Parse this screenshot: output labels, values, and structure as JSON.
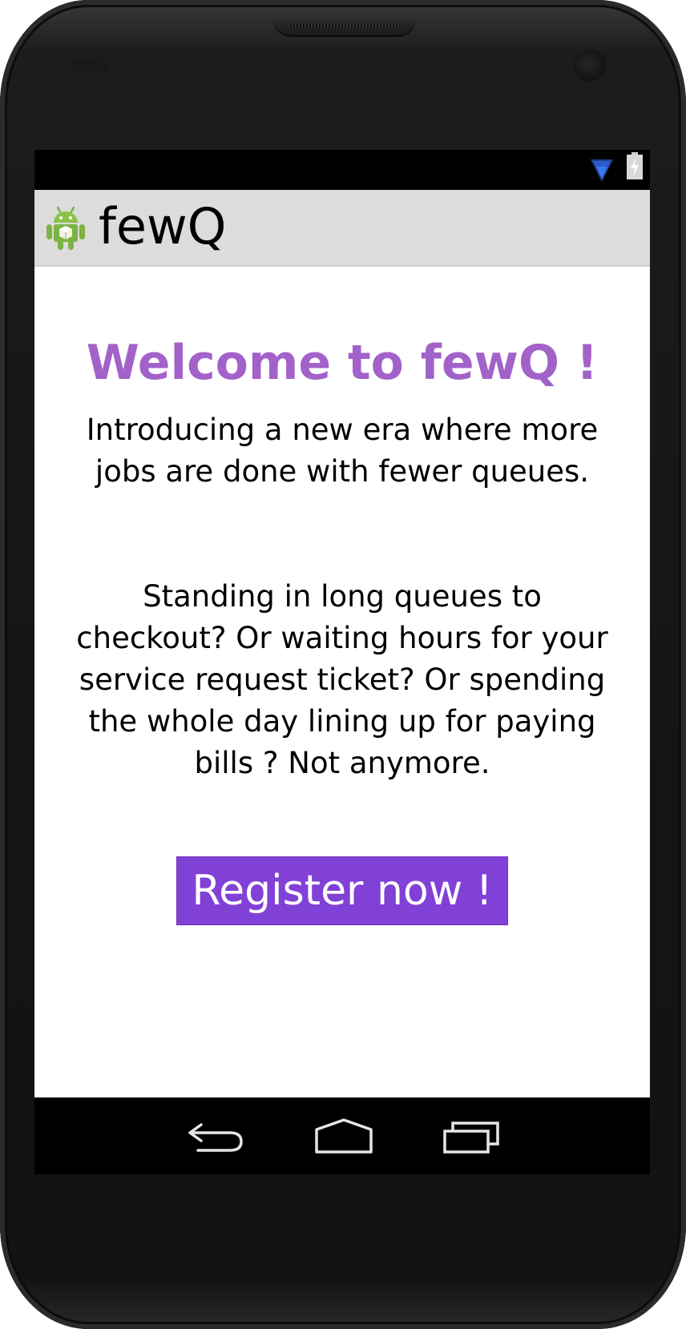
{
  "status_bar": {
    "wifi_icon": "wifi-signal-icon",
    "battery_icon": "battery-charging-icon"
  },
  "action_bar": {
    "app_icon": "android-robot-icon",
    "title": "fewQ"
  },
  "main": {
    "welcome_heading": "Welcome to fewQ !",
    "intro_text": "Introducing a new era where more jobs are done with fewer queues.",
    "pitch_text": "Standing in long queues to checkout? Or waiting hours for your service request ticket? Or spending the whole day lining up for paying bills ? Not anymore.",
    "register_button_label": "Register now !"
  },
  "navigation_bar": {
    "back_icon": "back-arrow-icon",
    "home_icon": "home-icon",
    "recents_icon": "recent-apps-icon"
  },
  "colors": {
    "heading": "#a262c9",
    "button": "#8140d6",
    "action_bar": "#dcdcdc"
  }
}
